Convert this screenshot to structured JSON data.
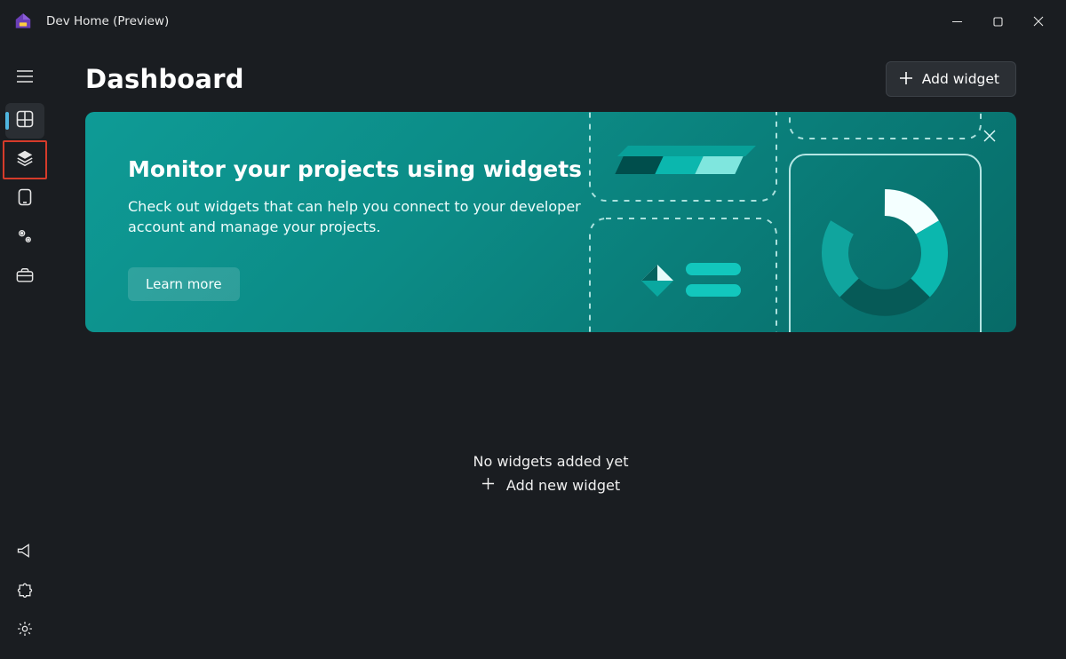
{
  "app": {
    "title": "Dev Home (Preview)"
  },
  "page": {
    "title": "Dashboard"
  },
  "toolbar": {
    "add_widget_label": "Add widget"
  },
  "banner": {
    "headline": "Monitor your projects using widgets",
    "body": "Check out widgets that can help you connect to your developer account and manage your projects.",
    "learn_more_label": "Learn more"
  },
  "empty_state": {
    "title": "No widgets added yet",
    "add_label": "Add new widget"
  },
  "icons": {
    "plus": "+"
  }
}
